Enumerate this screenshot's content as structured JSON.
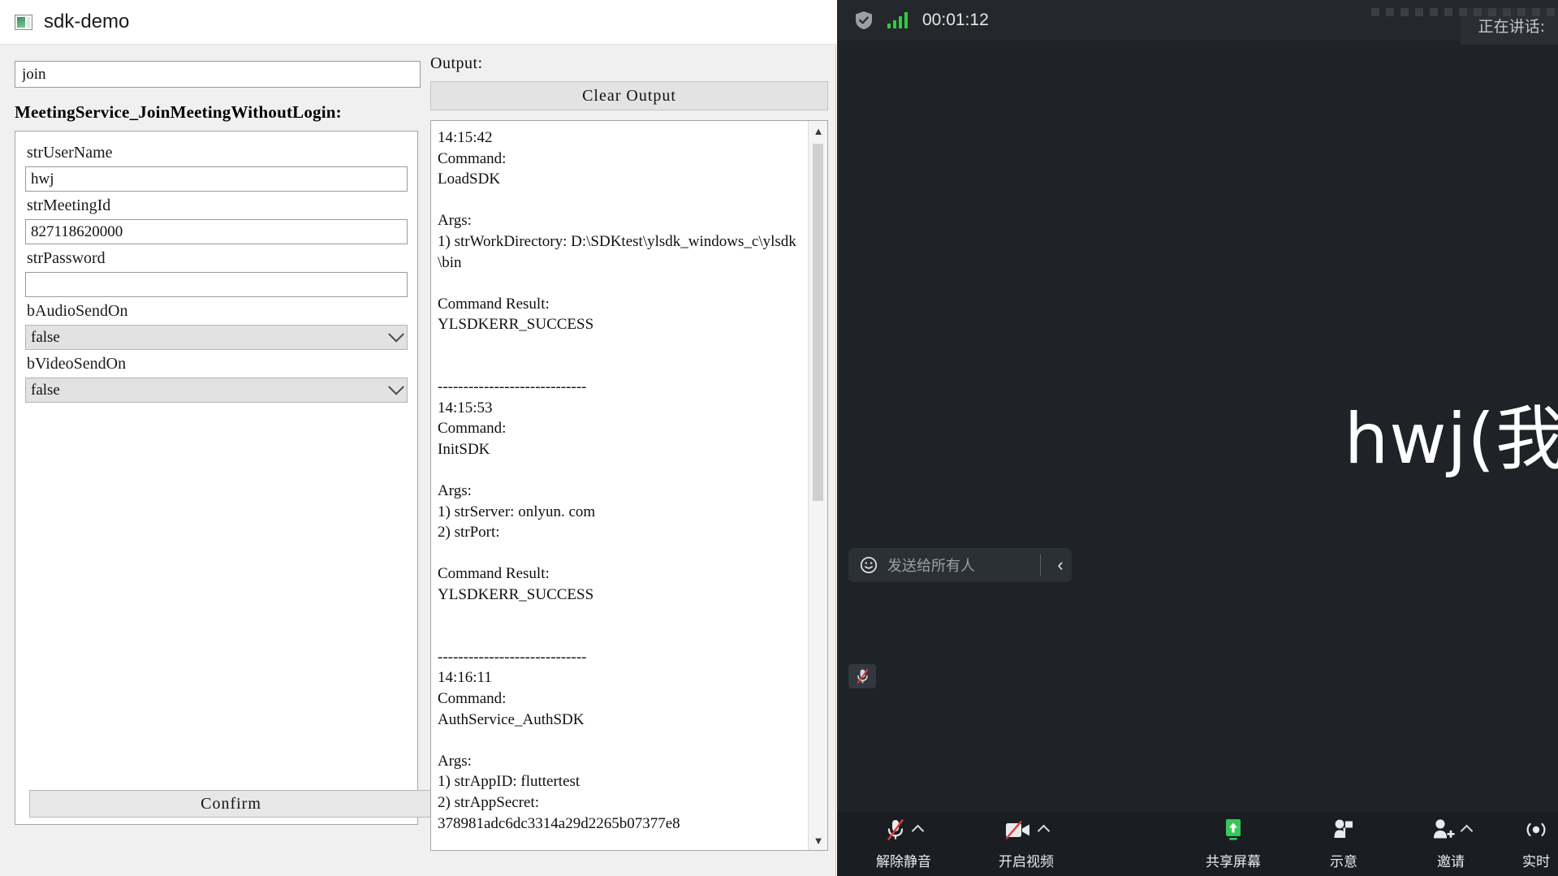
{
  "sdk_app": {
    "title": "sdk-demo",
    "icon": "app-window-icon",
    "command_input_value": "join",
    "section_title": "MeetingService_JoinMeetingWithoutLogin:",
    "fields": [
      {
        "label": "strUserName",
        "type": "text",
        "value": "hwj"
      },
      {
        "label": "strMeetingId",
        "type": "text",
        "value": "827118620000"
      },
      {
        "label": "strPassword",
        "type": "text",
        "value": ""
      },
      {
        "label": "bAudioSendOn",
        "type": "select",
        "value": "false"
      },
      {
        "label": "bVideoSendOn",
        "type": "select",
        "value": "false"
      }
    ],
    "confirm_label": "Confirm",
    "output_label": "Output:",
    "clear_output_label": "Clear Output",
    "output_text": "14:15:42\nCommand:\nLoadSDK\n\nArgs:\n1) strWorkDirectory: D:\\SDKtest\\ylsdk_windows_c\\ylsdk\\bin\n\nCommand Result:\nYLSDKERR_SUCCESS\n\n\n-----------------------------\n14:15:53\nCommand:\nInitSDK\n\nArgs:\n1) strServer: onlyun. com\n2) strPort:\n\nCommand Result:\nYLSDKERR_SUCCESS\n\n\n-----------------------------\n14:16:11\nCommand:\nAuthService_AuthSDK\n\nArgs:\n1) strAppID: fluttertest\n2) strAppSecret:\n378981adc6dc3314a29d2265b07377e8"
  },
  "zoom_meeting": {
    "shield_icon": "shield-check-icon",
    "signal_icon": "signal-bars-icon",
    "timer": "00:01:12",
    "speaking_label": "正在讲话:",
    "active_speaker_name": "hwj(我",
    "chat": {
      "emoji_icon": "smiley-icon",
      "placeholder": "发送给所有人",
      "prev_icon": "chevron-left-icon"
    },
    "self_mic_badge_icon": "mic-muted-icon",
    "toolbar": [
      {
        "label": "解除静音",
        "icon": "mic-muted-icon",
        "caret": true,
        "accent": ""
      },
      {
        "label": "开启视频",
        "icon": "camera-off-icon",
        "caret": true,
        "accent": ""
      },
      {
        "label": "共享屏幕",
        "icon": "share-screen-icon",
        "caret": false,
        "accent": "#35c759"
      },
      {
        "label": "示意",
        "icon": "reactions-icon",
        "caret": false,
        "accent": ""
      },
      {
        "label": "邀请",
        "icon": "invite-user-icon",
        "caret": true,
        "accent": ""
      },
      {
        "label": "实时",
        "icon": "live-icon",
        "caret": false,
        "accent": ""
      }
    ]
  }
}
